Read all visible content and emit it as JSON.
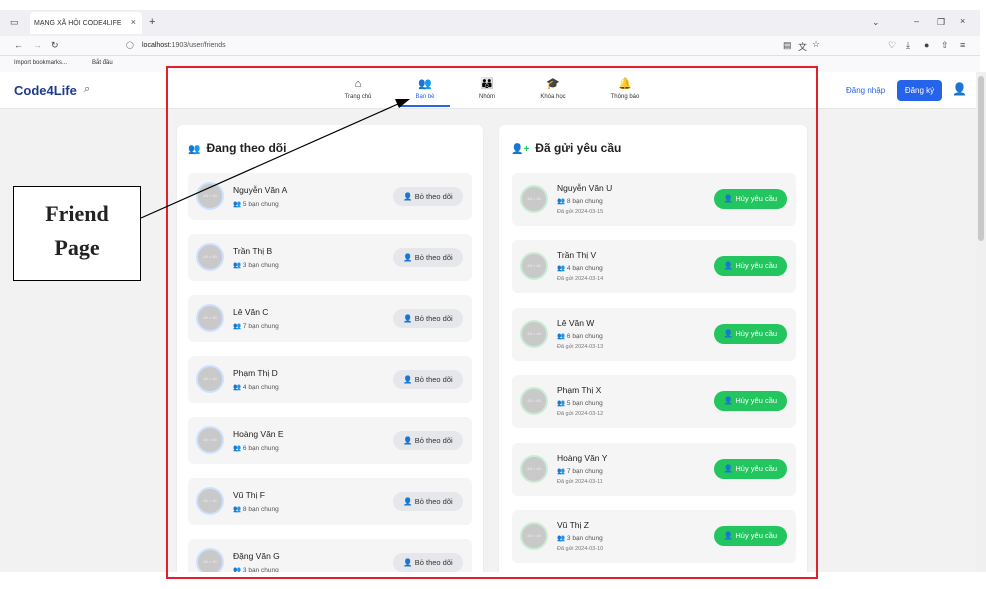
{
  "browser": {
    "tab_title": "MẠNG XÃ HỘI CODE4LIFE",
    "url_host": "localhost",
    "url_path": ":1903/user/friends",
    "bookmarks": [
      "Import bookmarks...",
      "Bắt đầu"
    ]
  },
  "navbar": {
    "brand": "Code4Life",
    "items": [
      {
        "label": "Trang chủ",
        "icon": "home-icon"
      },
      {
        "label": "Bạn bè",
        "icon": "friends-icon",
        "active": true
      },
      {
        "label": "Nhóm",
        "icon": "group-icon"
      },
      {
        "label": "Khóa học",
        "icon": "course-icon"
      },
      {
        "label": "Thông báo",
        "icon": "bell-icon"
      }
    ],
    "login": "Đăng nhập",
    "register": "Đăng ký"
  },
  "following": {
    "title": "Đang theo dõi",
    "button": "Bỏ theo dõi",
    "avatar_text": "48 × 48",
    "items": [
      {
        "name": "Nguyễn Văn A",
        "mutual": "5 bạn chung"
      },
      {
        "name": "Trần Thị B",
        "mutual": "3 bạn chung"
      },
      {
        "name": "Lê Văn C",
        "mutual": "7 bạn chung"
      },
      {
        "name": "Phạm Thị D",
        "mutual": "4 bạn chung"
      },
      {
        "name": "Hoàng Văn E",
        "mutual": "6 bạn chung"
      },
      {
        "name": "Vũ Thị F",
        "mutual": "8 bạn chung"
      },
      {
        "name": "Đặng Văn G",
        "mutual": "3 bạn chung"
      }
    ]
  },
  "sent": {
    "title": "Đã gửi yêu cầu",
    "button": "Hủy yêu cầu",
    "avatar_text": "48 × 48",
    "items": [
      {
        "name": "Nguyễn Văn U",
        "mutual": "8 bạn chung",
        "date": "Đã gửi 2024-03-15"
      },
      {
        "name": "Trần Thị V",
        "mutual": "4 bạn chung",
        "date": "Đã gửi 2024-03-14"
      },
      {
        "name": "Lê Văn W",
        "mutual": "6 bạn chung",
        "date": "Đã gửi 2024-03-13"
      },
      {
        "name": "Phạm Thị X",
        "mutual": "5 bạn chung",
        "date": "Đã gửi 2024-03-12"
      },
      {
        "name": "Hoàng Văn Y",
        "mutual": "7 bạn chung",
        "date": "Đã gửi 2024-03-11"
      },
      {
        "name": "Vũ Thị Z",
        "mutual": "3 bạn chung",
        "date": "Đã gửi 2024-03-10"
      }
    ]
  },
  "annotation": {
    "line1": "Friend",
    "line2": "Page",
    "color": "#e0202a"
  }
}
